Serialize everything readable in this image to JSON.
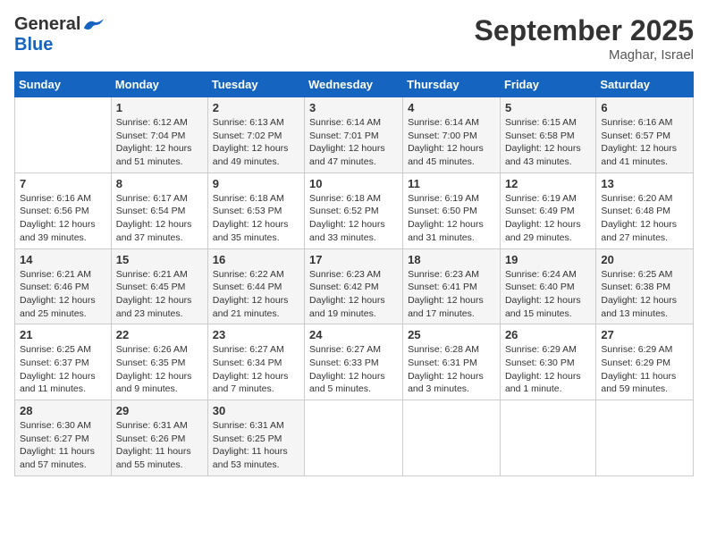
{
  "header": {
    "logo_general": "General",
    "logo_blue": "Blue",
    "month_title": "September 2025",
    "location": "Maghar, Israel"
  },
  "days_of_week": [
    "Sunday",
    "Monday",
    "Tuesday",
    "Wednesday",
    "Thursday",
    "Friday",
    "Saturday"
  ],
  "weeks": [
    [
      {
        "day": "",
        "info": ""
      },
      {
        "day": "1",
        "info": "Sunrise: 6:12 AM\nSunset: 7:04 PM\nDaylight: 12 hours\nand 51 minutes."
      },
      {
        "day": "2",
        "info": "Sunrise: 6:13 AM\nSunset: 7:02 PM\nDaylight: 12 hours\nand 49 minutes."
      },
      {
        "day": "3",
        "info": "Sunrise: 6:14 AM\nSunset: 7:01 PM\nDaylight: 12 hours\nand 47 minutes."
      },
      {
        "day": "4",
        "info": "Sunrise: 6:14 AM\nSunset: 7:00 PM\nDaylight: 12 hours\nand 45 minutes."
      },
      {
        "day": "5",
        "info": "Sunrise: 6:15 AM\nSunset: 6:58 PM\nDaylight: 12 hours\nand 43 minutes."
      },
      {
        "day": "6",
        "info": "Sunrise: 6:16 AM\nSunset: 6:57 PM\nDaylight: 12 hours\nand 41 minutes."
      }
    ],
    [
      {
        "day": "7",
        "info": "Sunrise: 6:16 AM\nSunset: 6:56 PM\nDaylight: 12 hours\nand 39 minutes."
      },
      {
        "day": "8",
        "info": "Sunrise: 6:17 AM\nSunset: 6:54 PM\nDaylight: 12 hours\nand 37 minutes."
      },
      {
        "day": "9",
        "info": "Sunrise: 6:18 AM\nSunset: 6:53 PM\nDaylight: 12 hours\nand 35 minutes."
      },
      {
        "day": "10",
        "info": "Sunrise: 6:18 AM\nSunset: 6:52 PM\nDaylight: 12 hours\nand 33 minutes."
      },
      {
        "day": "11",
        "info": "Sunrise: 6:19 AM\nSunset: 6:50 PM\nDaylight: 12 hours\nand 31 minutes."
      },
      {
        "day": "12",
        "info": "Sunrise: 6:19 AM\nSunset: 6:49 PM\nDaylight: 12 hours\nand 29 minutes."
      },
      {
        "day": "13",
        "info": "Sunrise: 6:20 AM\nSunset: 6:48 PM\nDaylight: 12 hours\nand 27 minutes."
      }
    ],
    [
      {
        "day": "14",
        "info": "Sunrise: 6:21 AM\nSunset: 6:46 PM\nDaylight: 12 hours\nand 25 minutes."
      },
      {
        "day": "15",
        "info": "Sunrise: 6:21 AM\nSunset: 6:45 PM\nDaylight: 12 hours\nand 23 minutes."
      },
      {
        "day": "16",
        "info": "Sunrise: 6:22 AM\nSunset: 6:44 PM\nDaylight: 12 hours\nand 21 minutes."
      },
      {
        "day": "17",
        "info": "Sunrise: 6:23 AM\nSunset: 6:42 PM\nDaylight: 12 hours\nand 19 minutes."
      },
      {
        "day": "18",
        "info": "Sunrise: 6:23 AM\nSunset: 6:41 PM\nDaylight: 12 hours\nand 17 minutes."
      },
      {
        "day": "19",
        "info": "Sunrise: 6:24 AM\nSunset: 6:40 PM\nDaylight: 12 hours\nand 15 minutes."
      },
      {
        "day": "20",
        "info": "Sunrise: 6:25 AM\nSunset: 6:38 PM\nDaylight: 12 hours\nand 13 minutes."
      }
    ],
    [
      {
        "day": "21",
        "info": "Sunrise: 6:25 AM\nSunset: 6:37 PM\nDaylight: 12 hours\nand 11 minutes."
      },
      {
        "day": "22",
        "info": "Sunrise: 6:26 AM\nSunset: 6:35 PM\nDaylight: 12 hours\nand 9 minutes."
      },
      {
        "day": "23",
        "info": "Sunrise: 6:27 AM\nSunset: 6:34 PM\nDaylight: 12 hours\nand 7 minutes."
      },
      {
        "day": "24",
        "info": "Sunrise: 6:27 AM\nSunset: 6:33 PM\nDaylight: 12 hours\nand 5 minutes."
      },
      {
        "day": "25",
        "info": "Sunrise: 6:28 AM\nSunset: 6:31 PM\nDaylight: 12 hours\nand 3 minutes."
      },
      {
        "day": "26",
        "info": "Sunrise: 6:29 AM\nSunset: 6:30 PM\nDaylight: 12 hours\nand 1 minute."
      },
      {
        "day": "27",
        "info": "Sunrise: 6:29 AM\nSunset: 6:29 PM\nDaylight: 11 hours\nand 59 minutes."
      }
    ],
    [
      {
        "day": "28",
        "info": "Sunrise: 6:30 AM\nSunset: 6:27 PM\nDaylight: 11 hours\nand 57 minutes."
      },
      {
        "day": "29",
        "info": "Sunrise: 6:31 AM\nSunset: 6:26 PM\nDaylight: 11 hours\nand 55 minutes."
      },
      {
        "day": "30",
        "info": "Sunrise: 6:31 AM\nSunset: 6:25 PM\nDaylight: 11 hours\nand 53 minutes."
      },
      {
        "day": "",
        "info": ""
      },
      {
        "day": "",
        "info": ""
      },
      {
        "day": "",
        "info": ""
      },
      {
        "day": "",
        "info": ""
      }
    ]
  ]
}
